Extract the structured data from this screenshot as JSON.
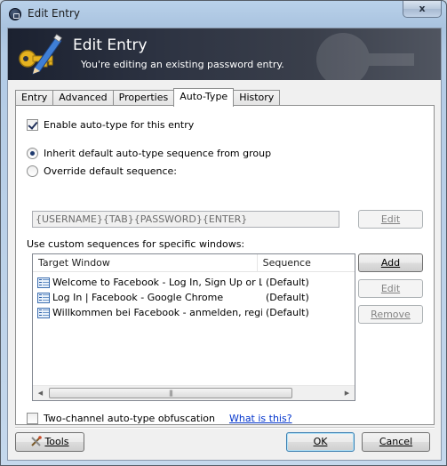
{
  "window": {
    "title": "Edit Entry",
    "close_glyph": "x"
  },
  "banner": {
    "title": "Edit Entry",
    "subtitle": "You're editing an existing password entry."
  },
  "tabs": [
    {
      "label": "Entry"
    },
    {
      "label": "Advanced"
    },
    {
      "label": "Properties"
    },
    {
      "label": "Auto-Type",
      "active": true
    },
    {
      "label": "History"
    }
  ],
  "autotype": {
    "enable_label": "Enable auto-type for this entry",
    "enable_checked": true,
    "inherit_label": "Inherit default auto-type sequence from group",
    "override_label": "Override default sequence:",
    "selected_option": "inherit",
    "sequence_value": "{USERNAME}{TAB}{PASSWORD}{ENTER}",
    "edit_label": "Edit",
    "custom_label": "Use custom sequences for specific windows:",
    "columns": [
      "Target Window",
      "Sequence"
    ],
    "rows": [
      {
        "window": "Welcome to Facebook - Log In, Sign Up or Le...",
        "sequence": "(Default)"
      },
      {
        "window": "Log In | Facebook - Google Chrome",
        "sequence": "(Default)"
      },
      {
        "window": "Willkommen bei Facebook - anmelden, registri...",
        "sequence": "(Default)"
      }
    ],
    "add_label": "Add",
    "edit2_label": "Edit",
    "remove_label": "Remove",
    "obfuscation_label": "Two-channel auto-type obfuscation",
    "obfuscation_checked": false,
    "help_link": "What is this?"
  },
  "footer": {
    "tools_label": "Tools",
    "ok_label": "OK",
    "cancel_label": "Cancel"
  }
}
